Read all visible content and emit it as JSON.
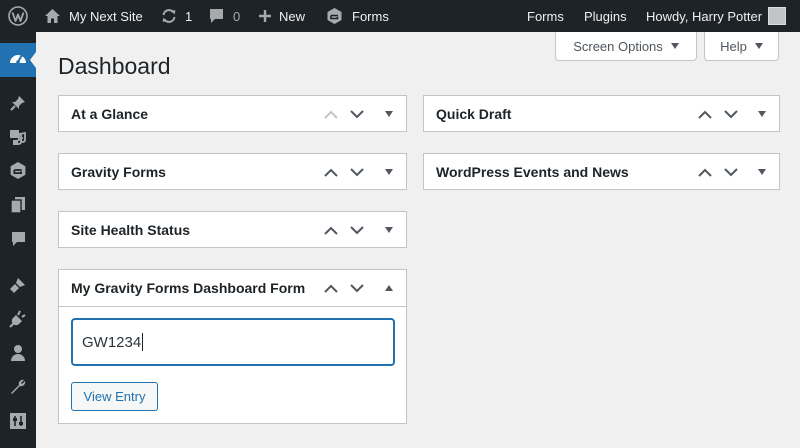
{
  "adminbar": {
    "site_name": "My Next Site",
    "updates_count": "1",
    "comments_count": "0",
    "new_label": "New",
    "forms_label": "Forms",
    "right_forms": "Forms",
    "right_plugins": "Plugins",
    "greeting": "Howdy, Harry Potter"
  },
  "header": {
    "title": "Dashboard",
    "screen_options": "Screen Options",
    "help": "Help"
  },
  "widgets": {
    "at_a_glance": "At a Glance",
    "gravity_forms": "Gravity Forms",
    "site_health": "Site Health Status",
    "dashboard_form": "My Gravity Forms Dashboard Form",
    "quick_draft": "Quick Draft",
    "events_news": "WordPress Events and News"
  },
  "form": {
    "entry_value": "GW1234",
    "view_entry": "View Entry"
  },
  "colors": {
    "adminbar_bg": "#1d2327",
    "accent": "#2271b1",
    "page_bg": "#f0f0f1"
  }
}
